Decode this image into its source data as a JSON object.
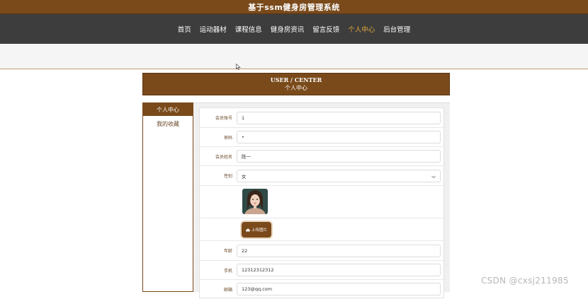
{
  "header": {
    "title": "基于ssm健身房管理系统"
  },
  "nav": {
    "items": [
      {
        "label": "首页"
      },
      {
        "label": "运动器材"
      },
      {
        "label": "课程信息"
      },
      {
        "label": "健身房资讯"
      },
      {
        "label": "留言反馈"
      },
      {
        "label": "个人中心",
        "active": true
      },
      {
        "label": "后台管理"
      }
    ]
  },
  "banner": {
    "en": "USER / CENTER",
    "cn": "个人中心"
  },
  "sidebar": {
    "items": [
      {
        "label": "个人中心",
        "active": true
      },
      {
        "label": "我的收藏"
      }
    ]
  },
  "form": {
    "account_label": "会员账号",
    "account_value": "1",
    "password_label": "密码",
    "password_value": "•",
    "name_label": "会员姓名",
    "name_value": "陈一",
    "gender_label": "性别",
    "gender_value": "女",
    "upload_label": "上传图片",
    "age_label": "年龄",
    "age_value": "22",
    "phone_label": "手机",
    "phone_value": "12312312312",
    "email_label": "邮箱",
    "email_value": "123@qq.com"
  },
  "watermark": "CSDN @cxsj211985",
  "colors": {
    "brand": "#7a4a1b",
    "nav_bg": "#3d3d3d",
    "nav_active": "#e4a93c"
  }
}
